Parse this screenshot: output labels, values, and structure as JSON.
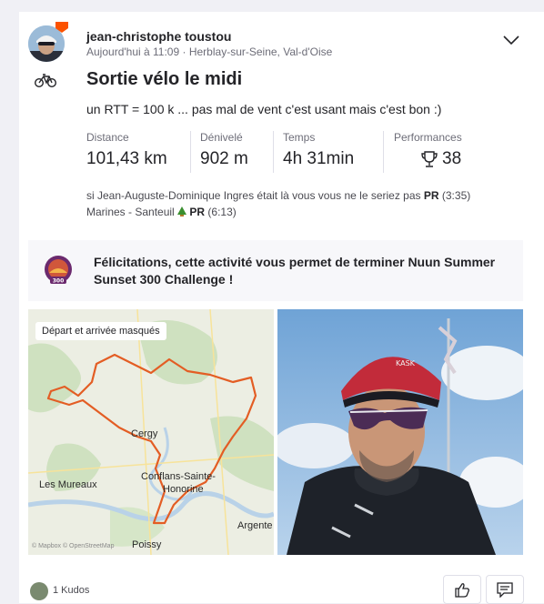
{
  "athlete": {
    "name": "jean-christophe toustou",
    "time": "Aujourd'hui à 11:09",
    "separator": "·",
    "location": "Herblay-sur-Seine, Val-d'Oise"
  },
  "activity": {
    "title": "Sortie vélo le midi",
    "description": "un RTT = 100 k ... pas mal de vent c'est usant mais c'est bon :)"
  },
  "stats": {
    "distance_label": "Distance",
    "distance_value": "101,43 km",
    "elevation_label": "Dénivelé",
    "elevation_value": "902 m",
    "time_label": "Temps",
    "time_value": "4h 31min",
    "performance_label": "Performances",
    "performance_value": "38"
  },
  "segments": [
    {
      "text": "si Jean-Auguste-Dominique Ingres était là vous vous ne le seriez pas",
      "pr": "PR",
      "time": "(3:35)"
    },
    {
      "text": "Marines - Santeuil",
      "pr": "PR",
      "time": "(6:13)"
    }
  ],
  "banner": {
    "text": "Félicitations, cette activité vous permet de terminer Nuun Summer Sunset 300 Challenge !",
    "badge_number": "300"
  },
  "map": {
    "chip": "Départ et arrivée masqués",
    "labels": {
      "cergy": "Cergy",
      "les_mureaux": "Les Mureaux",
      "conflans_1": "Conflans-Sainte-",
      "conflans_2": "Honorine",
      "argenteuil": "Argente",
      "poissy": "Poissy"
    },
    "copyright": "© Mapbox © OpenStreetMap",
    "route_color": "#e35d24"
  },
  "photo": {
    "helmet_brand": "KASK"
  },
  "footer": {
    "kudos": "1 Kudos"
  },
  "colors": {
    "accent": "#fc5200",
    "text": "#242428",
    "muted": "#6d6d78"
  }
}
